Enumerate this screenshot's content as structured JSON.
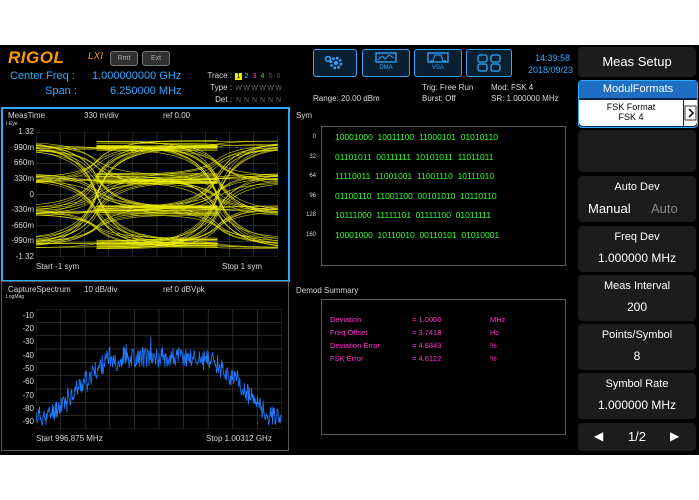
{
  "header": {
    "logo": "RIGOL",
    "lxi": "LXI",
    "rmt": "Rmt",
    "ext": "Ext",
    "center_freq_label": "Center Freq :",
    "center_freq_value": "1.000000000 GHz",
    "span_label": "Span :",
    "span_value": "6.250000 MHz",
    "trace_label": "Trace :",
    "trace_nums": [
      "1",
      "2",
      "3",
      "4",
      "5",
      "6"
    ],
    "type_label": "Type :",
    "type_values": [
      "W",
      "W",
      "W",
      "W",
      "W",
      "W"
    ],
    "det_label": "Det :",
    "det_values": [
      "N",
      "N",
      "N",
      "N",
      "N",
      "N"
    ],
    "range": "Range: 20.00 dBm",
    "trig": "Trig: Free Run",
    "burst": "Burst: Off",
    "mod": "Mod: FSK 4",
    "sr": "SR: 1.000000 MHz",
    "btn_dma": "DMA",
    "btn_vsa": "VSA",
    "time": "14:39:58",
    "date": "2018/09/23"
  },
  "eye": {
    "title": "MeasTime",
    "scale": "330 m/div",
    "ref": "ref 0.00",
    "unit": "I-Eye",
    "yticks": [
      "1.32",
      "990m",
      "660m",
      "330m",
      "0",
      "-330m",
      "-660m",
      "-990m",
      "-1.32"
    ],
    "start": "Start -1 sym",
    "stop": "Stop 1 sym"
  },
  "sym": {
    "title": "Sym",
    "rows": [
      {
        "idx": "0",
        "bits": "10001000  10011100  11000101  01010110"
      },
      {
        "idx": "32",
        "bits": "01101011  00111111  10101011  11011011"
      },
      {
        "idx": "64",
        "bits": "11110011  11001001  11001110  10111010"
      },
      {
        "idx": "96",
        "bits": "01100110  11001100  00101010  10110110"
      },
      {
        "idx": "128",
        "bits": "10111000  11111101  01111100  01011111"
      },
      {
        "idx": "160",
        "bits": "10001000  10110010  00110101  01010001"
      }
    ]
  },
  "spectrum": {
    "title": "CaptureSpectrum",
    "scale": "10 dB/div",
    "ref": "ref 0 dBVpk",
    "unit": "LogMag",
    "yticks": [
      "-10",
      "-20",
      "-30",
      "-40",
      "-50",
      "-60",
      "-70",
      "-80",
      "-90"
    ],
    "start": "Start 996.875 MHz",
    "stop": "Stop 1.00312 GHz"
  },
  "demod": {
    "title": "Demod Summary",
    "rows": [
      {
        "name": "Deviation",
        "value": "= 1.0000",
        "unit": "MHz"
      },
      {
        "name": "Freq Offset",
        "value": "= 3.7418",
        "unit": "Hz"
      },
      {
        "name": "Deviation Error",
        "value": "= 4.5843",
        "unit": "%"
      },
      {
        "name": "FSK Error",
        "value": "= 4.6122",
        "unit": "%"
      }
    ]
  },
  "menu": {
    "title": "Meas Setup",
    "modul_formats": "ModulFormats",
    "fsk_format_label": "FSK Format",
    "fsk_format_value": "FSK 4",
    "auto_dev": "Auto Dev",
    "manual": "Manual",
    "auto": "Auto",
    "freq_dev_label": "Freq Dev",
    "freq_dev_value": "1.000000 MHz",
    "meas_interval_label": "Meas Interval",
    "meas_interval_value": "200",
    "points_symbol_label": "Points/Symbol",
    "points_symbol_value": "8",
    "symbol_rate_label": "Symbol Rate",
    "symbol_rate_value": "1.000000 MHz",
    "page": "1/2"
  },
  "colors": {
    "accent": "#2fa8ff",
    "trace_yellow": "#f0f000",
    "bits_green": "#33ff33",
    "summary_magenta": "#ff33cc",
    "spectrum_blue": "#1e7bff",
    "logo_orange": "#ff9a00"
  }
}
